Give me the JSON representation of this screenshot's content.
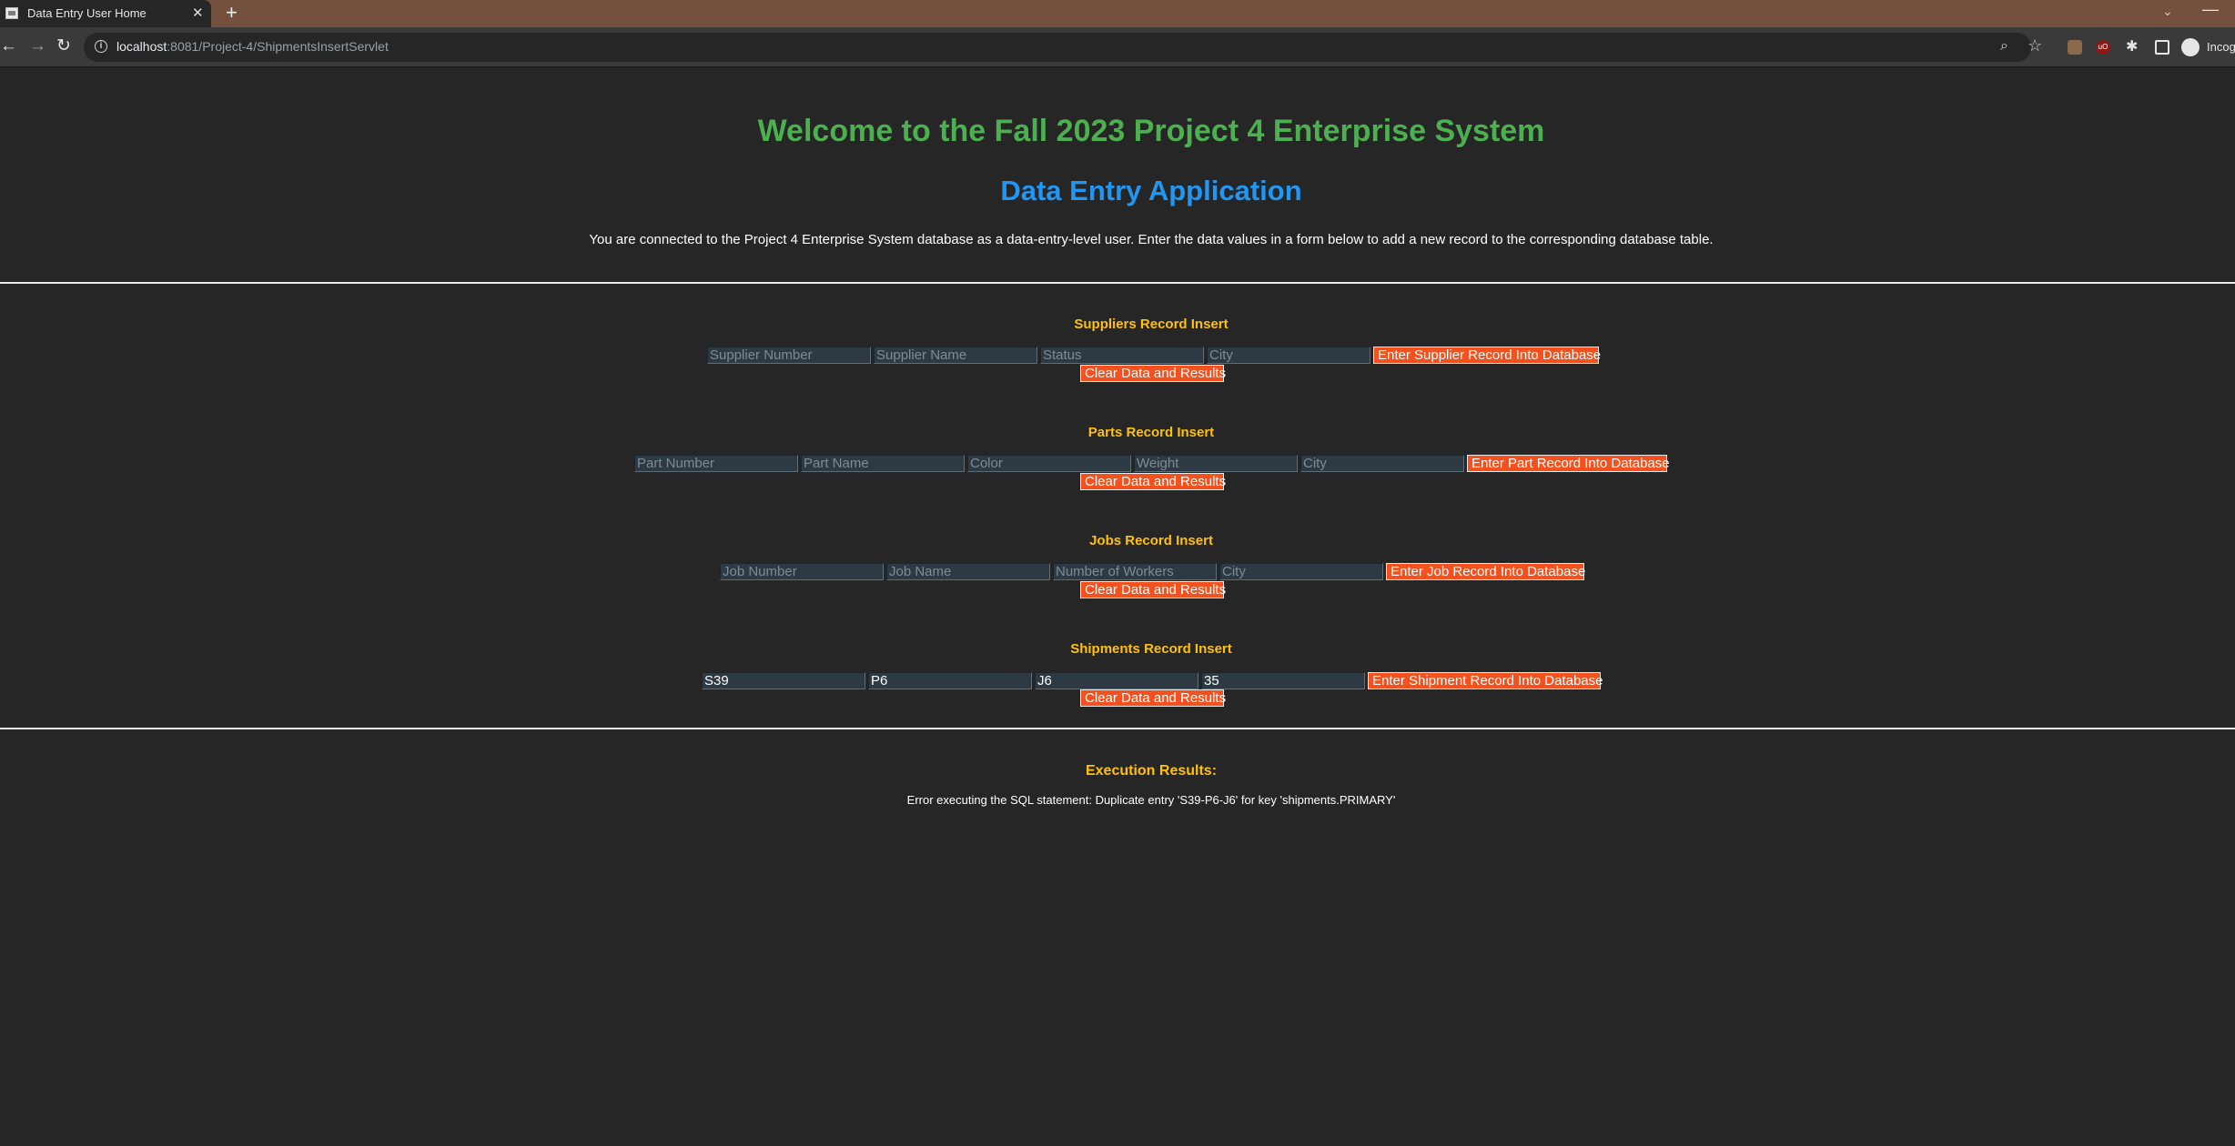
{
  "browser": {
    "tab_title": "Data Entry User Home",
    "tab_close": "✕",
    "new_tab": "+",
    "url_host": "localhost",
    "url_rest": ":8081/Project-4/ShipmentsInsertServlet",
    "incognito_label": "Incognito"
  },
  "page": {
    "title": "Welcome to the Fall 2023 Project 4 Enterprise System",
    "subtitle": "Data Entry Application",
    "intro": "You are connected to the Project 4 Enterprise System database as a data-entry-level user. Enter the data values in a form below to add a new record to the corresponding database table."
  },
  "suppliers": {
    "title": "Suppliers Record Insert",
    "fields": [
      {
        "placeholder": "Supplier Number",
        "value": ""
      },
      {
        "placeholder": "Supplier Name",
        "value": ""
      },
      {
        "placeholder": "Status",
        "value": ""
      },
      {
        "placeholder": "City",
        "value": ""
      }
    ],
    "submit": "Enter Supplier Record Into Database",
    "clear": "Clear Data and Results"
  },
  "parts": {
    "title": "Parts Record Insert",
    "fields": [
      {
        "placeholder": "Part Number",
        "value": ""
      },
      {
        "placeholder": "Part Name",
        "value": ""
      },
      {
        "placeholder": "Color",
        "value": ""
      },
      {
        "placeholder": "Weight",
        "value": ""
      },
      {
        "placeholder": "City",
        "value": ""
      }
    ],
    "submit": "Enter Part Record Into Database",
    "clear": "Clear Data and Results"
  },
  "jobs": {
    "title": "Jobs Record Insert",
    "fields": [
      {
        "placeholder": "Job Number",
        "value": ""
      },
      {
        "placeholder": "Job Name",
        "value": ""
      },
      {
        "placeholder": "Number of Workers",
        "value": ""
      },
      {
        "placeholder": "City",
        "value": ""
      }
    ],
    "submit": "Enter Job Record Into Database",
    "clear": "Clear Data and Results"
  },
  "shipments": {
    "title": "Shipments Record Insert",
    "fields": [
      {
        "placeholder": "",
        "value": "S39"
      },
      {
        "placeholder": "",
        "value": "P6"
      },
      {
        "placeholder": "",
        "value": "J6"
      },
      {
        "placeholder": "",
        "value": "35"
      }
    ],
    "submit": "Enter Shipment Record Into Database",
    "clear": "Clear Data and Results"
  },
  "results": {
    "title": "Execution Results:",
    "message": "Error executing the SQL statement: Duplicate entry 'S39-P6-J6' for key 'shipments.PRIMARY'"
  }
}
